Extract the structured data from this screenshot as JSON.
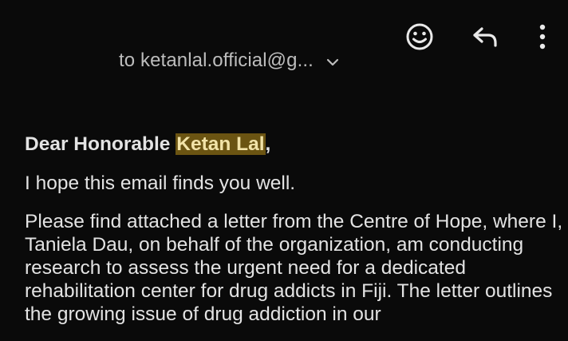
{
  "recipient": {
    "prefix": "to",
    "address": "ketanlal.official@g..."
  },
  "icons": {
    "emoji": "smiley-face-icon",
    "reply": "reply-arrow-icon",
    "more": "more-vertical-icon",
    "expand": "chevron-down-icon"
  },
  "email": {
    "greeting_prefix": "Dear Honorable ",
    "greeting_name": "Ketan Lal",
    "greeting_suffix": ",",
    "paragraphs": [
      "I hope this email finds you well.",
      "Please find attached a letter from the Centre of Hope, where I, Taniela Dau, on behalf of the organization, am conducting research to assess the urgent need for a dedicated rehabilitation center for drug addicts in Fiji. The letter outlines the growing issue of drug addiction in our"
    ]
  },
  "colors": {
    "background": "#0a0a0a",
    "highlight": "#6b5412"
  }
}
